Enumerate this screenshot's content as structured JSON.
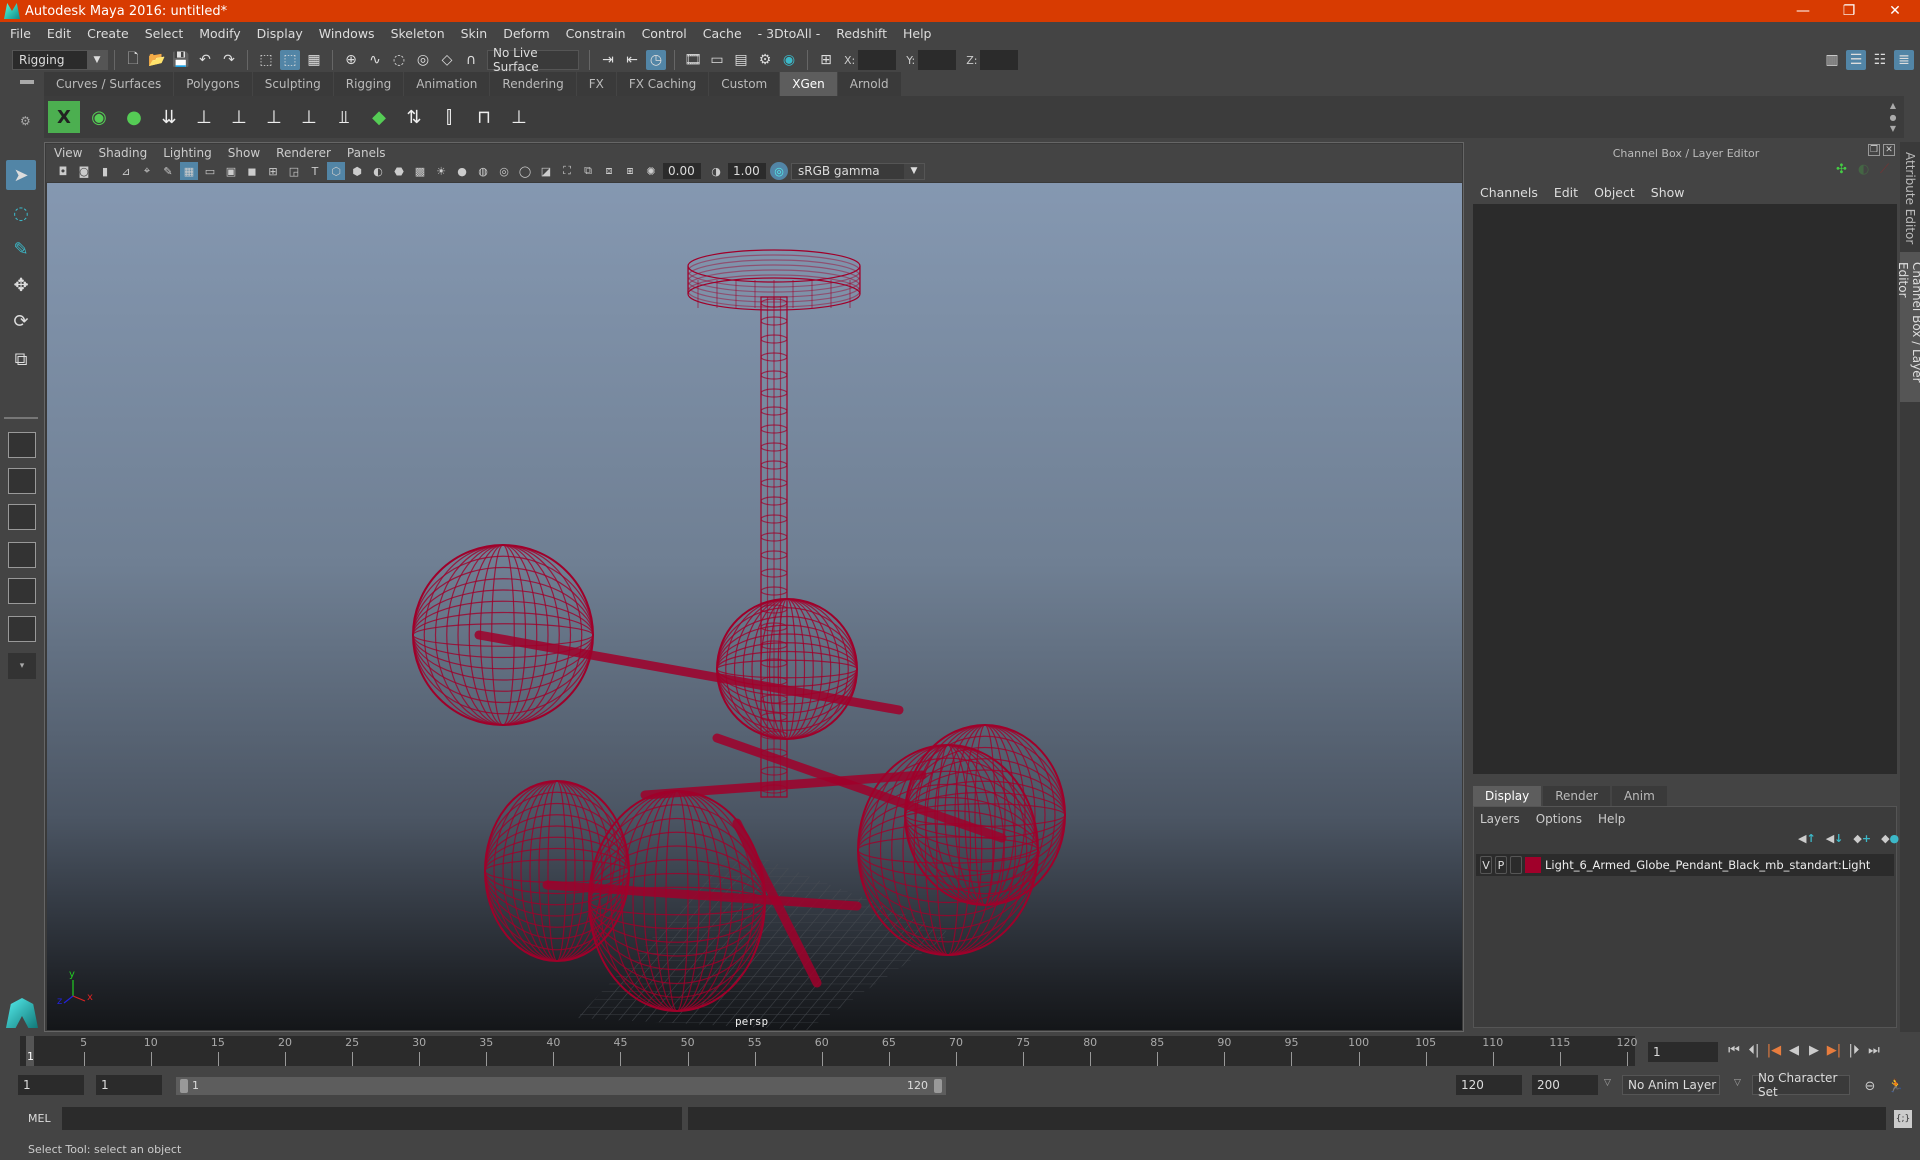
{
  "window": {
    "title": "Autodesk Maya 2016: untitled*",
    "controls": {
      "minimize": "—",
      "restore": "❐",
      "close": "✕"
    }
  },
  "menubar": [
    "File",
    "Edit",
    "Create",
    "Select",
    "Modify",
    "Display",
    "Windows",
    "Skeleton",
    "Skin",
    "Deform",
    "Constrain",
    "Control",
    "Cache",
    "- 3DtoAll -",
    "Redshift",
    "Help"
  ],
  "statusline": {
    "menuset": "Rigging",
    "live_surface": "No Live Surface",
    "coords": {
      "x_label": "X:",
      "y_label": "Y:",
      "z_label": "Z:",
      "x": "",
      "y": "",
      "z": ""
    }
  },
  "shelf": {
    "tabs": [
      "Curves / Surfaces",
      "Polygons",
      "Sculpting",
      "Rigging",
      "Animation",
      "Rendering",
      "FX",
      "FX Caching",
      "Custom",
      "XGen",
      "Arnold"
    ],
    "active_tab": "XGen"
  },
  "panel": {
    "menu": [
      "View",
      "Shading",
      "Lighting",
      "Show",
      "Renderer",
      "Panels"
    ],
    "exposure": "0.00",
    "gamma": "1.00",
    "color_space": "sRGB gamma",
    "camera_label": "persp",
    "axis": {
      "x": "x",
      "y": "y",
      "z": "z"
    }
  },
  "scene": {
    "wire_color": "#a0002a",
    "object_name": "Light_6_Armed_Globe_Pendant_Black_mb_standart:Light"
  },
  "channel_box": {
    "header": "Channel Box / Layer Editor",
    "menu": [
      "Channels",
      "Edit",
      "Object",
      "Show"
    ]
  },
  "layer_editor": {
    "tabs": [
      "Display",
      "Render",
      "Anim"
    ],
    "active_tab": "Display",
    "menu": [
      "Layers",
      "Options",
      "Help"
    ],
    "layers": [
      {
        "visible": "V",
        "playback": "P",
        "color": "#a0002a",
        "name": "Light_6_Armed_Globe_Pendant_Black_mb_standart:Light"
      }
    ]
  },
  "side_tabs": [
    "Attribute Editor",
    "Channel Box / Layer Editor"
  ],
  "timeline": {
    "ticks": [
      5,
      10,
      15,
      20,
      25,
      30,
      35,
      40,
      45,
      50,
      55,
      60,
      65,
      70,
      75,
      80,
      85,
      90,
      95,
      100,
      105,
      110,
      115,
      120
    ],
    "current_frame": "1",
    "current_frame_field": "1",
    "range_start": 1,
    "range_end": 120
  },
  "range": {
    "start_field": "1",
    "playback_start": "1",
    "slider_start": "1",
    "slider_end": "120",
    "playback_end": "120",
    "end_field": "200",
    "anim_layer": "No Anim Layer",
    "character_set": "No Character Set"
  },
  "command_line": {
    "label": "MEL",
    "value": "",
    "result": ""
  },
  "help_line": "Select Tool: select an object",
  "colors": {
    "title_bar": "#d83b01",
    "accent": "#5285a6",
    "active_tab": "#5d5d5d"
  }
}
